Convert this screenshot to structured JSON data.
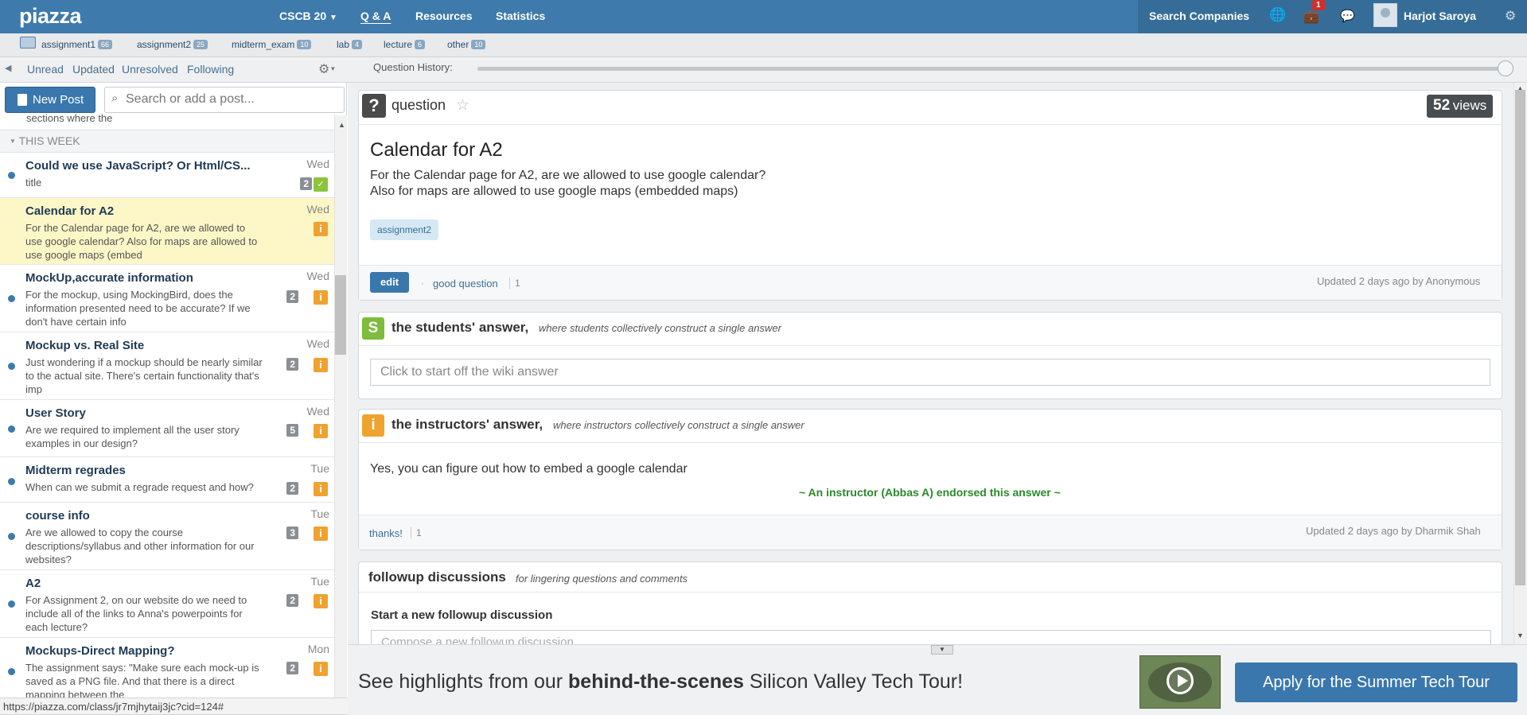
{
  "topbar": {
    "logo": "piazza",
    "class_name": "CSCB 20",
    "nav": {
      "qa": "Q & A",
      "resources": "Resources",
      "statistics": "Statistics"
    },
    "search_companies": "Search Companies",
    "notification_count": "1",
    "username": "Harjot Saroya"
  },
  "folders": [
    {
      "label": "assignment1",
      "count": "66"
    },
    {
      "label": "assignment2",
      "count": "25"
    },
    {
      "label": "midterm_exam",
      "count": "10"
    },
    {
      "label": "lab",
      "count": "4"
    },
    {
      "label": "lecture",
      "count": "6"
    },
    {
      "label": "other",
      "count": "10"
    }
  ],
  "filters": {
    "unread": "Unread",
    "updated": "Updated",
    "unresolved": "Unresolved",
    "following": "Following"
  },
  "question_history_label": "Question History:",
  "feed": {
    "new_post": "New Post",
    "search_placeholder": "Search or add a post...",
    "cut_off_text": "sections where the",
    "section": "THIS WEEK",
    "posts": [
      {
        "title": "Could we use JavaScript? Or Html/CS...",
        "snippet": "title",
        "date": "Wed",
        "count": "2",
        "badge": "good"
      },
      {
        "title": "Calendar for A2",
        "snippet": "For the Calendar page for A2, are we allowed to use google calendar? Also for maps are allowed to use google maps (embed",
        "date": "Wed",
        "count": "",
        "badge": "i"
      },
      {
        "title": "MockUp,accurate information",
        "snippet": "For the mockup, using MockingBird, does the information presented need to be accurate? If we don't have certain info",
        "date": "Wed",
        "count": "2",
        "badge": "i"
      },
      {
        "title": "Mockup vs. Real Site",
        "snippet": "Just wondering if a mockup should be nearly similar to the actual site. There's certain functionality that's imp",
        "date": "Wed",
        "count": "2",
        "badge": "i"
      },
      {
        "title": "User Story",
        "snippet": "Are we required to implement all the user story examples in our design?",
        "date": "Wed",
        "count": "5",
        "badge": "i"
      },
      {
        "title": "Midterm regrades",
        "snippet": "When can we submit a regrade request and how?",
        "date": "Tue",
        "count": "2",
        "badge": "i"
      },
      {
        "title": "course info",
        "snippet": "Are we allowed to copy the course descriptions/syllabus and other information for our websites?",
        "date": "Tue",
        "count": "3",
        "badge": "i"
      },
      {
        "title": "A2",
        "snippet": "For Assignment 2, on our website do we need to include all of the links to Anna's powerpoints for each lecture?",
        "date": "Tue",
        "count": "2",
        "badge": "i"
      },
      {
        "title": "Mockups-Direct Mapping?",
        "snippet": "The assignment says: \"Make sure each mock-up is saved as a PNG file. And that there is a direct mapping between the",
        "date": "Mon",
        "count": "2",
        "badge": "i"
      }
    ]
  },
  "status_url": "https://piazza.com/class/jr7mjhytaij3jc?cid=124#",
  "question": {
    "type": "question",
    "views": "52",
    "views_label": "views",
    "title": "Calendar for A2",
    "body_line1": "For the Calendar page for A2, are we allowed to use google calendar?",
    "body_line2": "Also for maps are allowed to use google maps (embedded maps)",
    "tag": "assignment2",
    "edit": "edit",
    "good_question": "good question",
    "good_count": "1",
    "updated": "Updated 2 days ago by Anonymous"
  },
  "students_answer": {
    "icon": "S",
    "heading": "the students' answer,",
    "sub": "where students collectively construct a single answer",
    "placeholder": "Click to start off the wiki answer"
  },
  "instructors_answer": {
    "icon": "i",
    "heading": "the instructors' answer,",
    "sub": "where instructors collectively construct a single answer",
    "text": "Yes, you can figure out how to embed a google calendar",
    "endorsed": "~ An instructor (Abbas A) endorsed this answer ~",
    "thanks": "thanks!",
    "thanks_count": "1",
    "updated": "Updated 2 days ago by Dharmik Shah"
  },
  "followup": {
    "heading": "followup discussions",
    "sub": "for lingering questions and comments",
    "start": "Start a new followup discussion",
    "compose_placeholder": "Compose a new followup discussion"
  },
  "ad": {
    "text_pre": "See highlights from our ",
    "text_bold": "behind-the-scenes",
    "text_post": " Silicon Valley Tech Tour!",
    "button": "Apply for the Summer Tech Tour"
  },
  "colors": {
    "brand": "#3e7aab",
    "instructor": "#f0a22e",
    "student": "#7ebc3e",
    "highlight": "#fdf7c7"
  }
}
